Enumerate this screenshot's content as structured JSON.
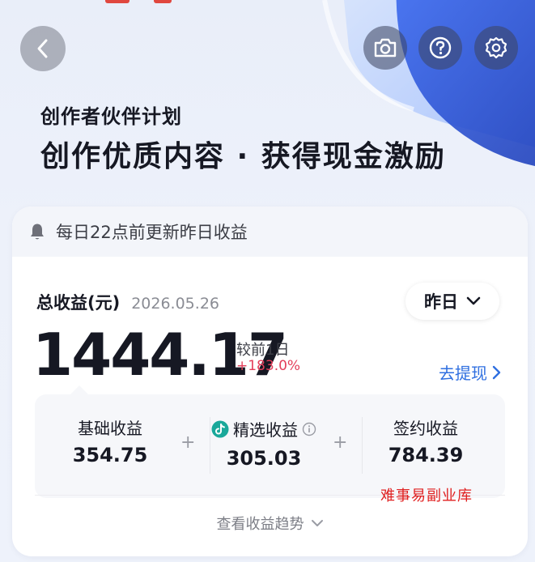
{
  "hero": {
    "subtitle": "创作者伙伴计划",
    "headline": "创作优质内容 · 获得现金激励"
  },
  "notice": {
    "icon": "bell-icon",
    "text": "每日22点前更新昨日收益"
  },
  "earnings": {
    "title": "总收益(元)",
    "date": "2026.05.26",
    "period_selected": "昨日",
    "total": "1444.17",
    "compare_label": "较前1日",
    "compare_value": "+183.0%",
    "withdraw_label": "去提现"
  },
  "breakdown": [
    {
      "label": "基础收益",
      "value": "354.75"
    },
    {
      "label": "精选收益",
      "value": "305.03",
      "icon": "tiktok-icon",
      "info_icon": "info-icon"
    },
    {
      "label": "签约收益",
      "value": "784.39"
    }
  ],
  "operators": [
    "+",
    "+"
  ],
  "trend_link": "查看收益趋势",
  "watermark": "难事易副业库",
  "colors": {
    "accent_blue": "#2f6fe0",
    "increase_red": "#e33e5a",
    "watermark_red": "#e02020"
  },
  "top_icons": [
    "back-arrow-icon",
    "camera-icon",
    "help-icon",
    "gear-icon"
  ]
}
